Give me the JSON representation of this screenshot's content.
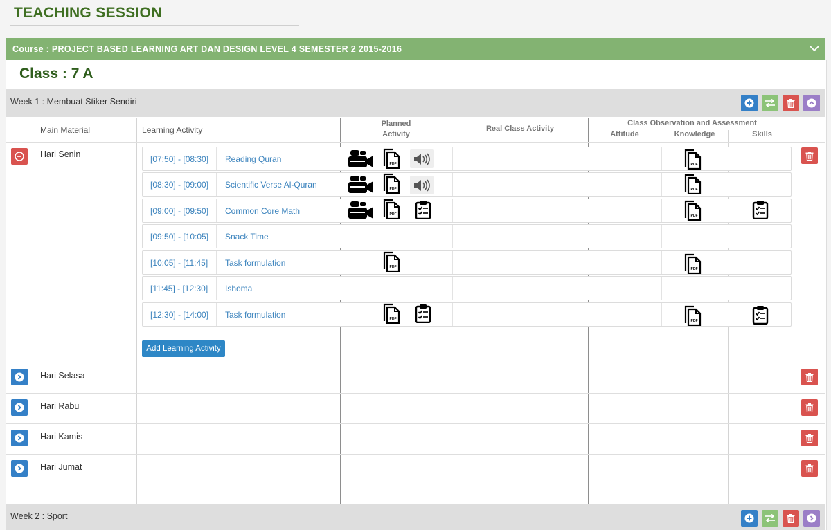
{
  "page": {
    "title": "TEACHING SESSION"
  },
  "course": {
    "label": "Course : PROJECT BASED LEARNING ART DAN DESIGN LEVEL 4 SEMESTER 2 2015-2016"
  },
  "class": {
    "label": "Class : 7 A"
  },
  "weeks": [
    {
      "label": "Week 1 : Membuat Stiker Sendiri"
    },
    {
      "label": "Week 2 : Sport"
    }
  ],
  "table": {
    "headers": {
      "main_material": "Main Material",
      "learning_activity": "Learning Activity",
      "planned_1": "Planned",
      "planned_2": "Activity",
      "real_class": "Real Class Activity",
      "observation": "Class Observation and Assessment",
      "attitude": "Attitude",
      "knowledge": "Knowledge",
      "skills": "Skills"
    }
  },
  "days": [
    {
      "name": "Hari Senin"
    },
    {
      "name": "Hari Selasa"
    },
    {
      "name": "Hari Rabu"
    },
    {
      "name": "Hari Kamis"
    },
    {
      "name": "Hari Jumat"
    }
  ],
  "activities": [
    {
      "time": "[07:50] - [08:30]",
      "name": "Reading Quran",
      "planned": [
        "video-icon",
        "pdf-icon",
        "audio-icon"
      ],
      "knowledge": "pdf-icon",
      "skills": ""
    },
    {
      "time": "[08:30] - [09:00]",
      "name": "Scientific Verse Al-Quran",
      "planned": [
        "video-icon",
        "pdf-icon",
        "audio-icon"
      ],
      "knowledge": "pdf-icon",
      "skills": ""
    },
    {
      "time": "[09:00] - [09:50]",
      "name": "Common Core Math",
      "planned": [
        "video-icon",
        "pdf-icon",
        "checklist-icon"
      ],
      "knowledge": "pdf-icon",
      "skills": "checklist-icon"
    },
    {
      "time": "[09:50] - [10:05]",
      "name": "Snack Time",
      "planned": [],
      "knowledge": "",
      "skills": ""
    },
    {
      "time": "[10:05] - [11:45]",
      "name": "Task formulation",
      "planned": [
        "pdf-icon"
      ],
      "knowledge": "pdf-icon",
      "skills": ""
    },
    {
      "time": "[11:45] - [12:30]",
      "name": "Ishoma",
      "planned": [],
      "knowledge": "",
      "skills": ""
    },
    {
      "time": "[12:30] - [14:00]",
      "name": "Task formulation",
      "planned": [
        "pdf-icon",
        "checklist-icon"
      ],
      "knowledge": "pdf-icon",
      "skills": "checklist-icon"
    }
  ],
  "buttons": {
    "add_activity": "Add Learning Activity"
  },
  "colors": {
    "accent_green": "#83b372",
    "title_green": "#3f6f22",
    "link_blue": "#3b83bd",
    "danger_red": "#d9534f",
    "primary_blue": "#3480c7",
    "purple": "#9b7ec7"
  }
}
